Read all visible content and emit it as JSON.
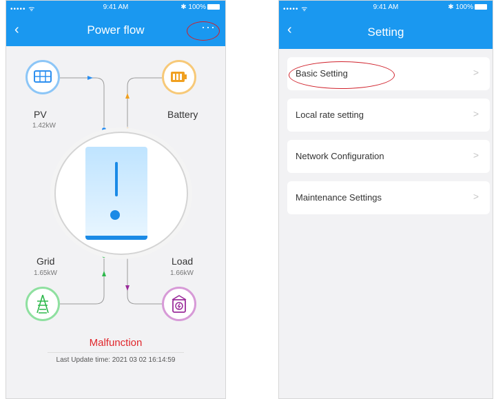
{
  "left_screen": {
    "status": {
      "signal": "••••• ᯤ",
      "time": "9:41 AM",
      "battery": "✱ 100%"
    },
    "nav": {
      "back_icon": "chevron-left-icon",
      "title": "Power flow",
      "more": "···"
    },
    "nodes": {
      "pv": {
        "label": "PV",
        "value": "1.42kW",
        "icon": "solar-panel-icon",
        "color": "#2c8ff0"
      },
      "battery": {
        "label": "Battery",
        "value": "",
        "icon": "battery-icon",
        "color": "#f0a020"
      },
      "grid": {
        "label": "Grid",
        "value": "1.65kW",
        "icon": "power-tower-icon",
        "color": "#2db84b"
      },
      "load": {
        "label": "Load",
        "value": "1.66kW",
        "icon": "load-icon",
        "color": "#9a2b9a"
      }
    },
    "status_text": "Malfunction",
    "last_update": "Last Update time:  2021 03 02  16:14:59"
  },
  "right_screen": {
    "status": {
      "signal": "••••• ᯤ",
      "time": "9:41 AM",
      "battery": "✱ 100%"
    },
    "nav": {
      "back_icon": "chevron-left-icon",
      "title": "Setting"
    },
    "menu": [
      {
        "label": "Basic Setting",
        "chevron": ">"
      },
      {
        "label": "Local rate setting",
        "chevron": ">"
      },
      {
        "label": "Network Configuration",
        "chevron": ">"
      },
      {
        "label": "Maintenance Settings",
        "chevron": ">"
      }
    ]
  },
  "colors": {
    "accent": "#1a98f0",
    "alert": "#e0262b",
    "highlight_ring": "#d0202a"
  }
}
